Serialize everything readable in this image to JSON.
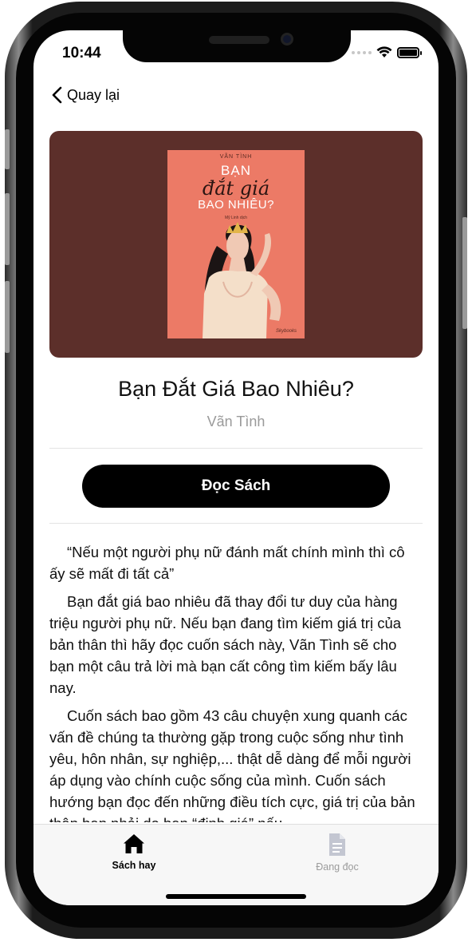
{
  "status_bar": {
    "time": "10:44"
  },
  "nav": {
    "back_label": "Quay lại"
  },
  "cover": {
    "author": "VÃN TÌNH",
    "title_line1": "BẠN",
    "title_line2": "đắt giá",
    "title_line3": "BAO NHIÊU?",
    "subtitle": "Mỹ Linh dịch",
    "publisher": "Skybooks"
  },
  "book": {
    "title": "Bạn Đắt Giá Bao Nhiêu?",
    "author": "Vãn Tình"
  },
  "actions": {
    "read_label": "Đọc Sách"
  },
  "description": [
    "“Nếu một người phụ nữ đánh mất chính mình thì cô ấy sẽ mất đi tất cả”",
    "Bạn đắt giá bao nhiêu đã thay đổi tư duy của hàng triệu người phụ nữ. Nếu bạn đang tìm kiếm giá trị của bản thân thì hãy đọc cuốn sách này, Vãn Tình sẽ cho bạn một câu trả lời mà bạn cất công tìm kiếm bấy lâu nay.",
    "Cuốn sách bao gồm 43 câu chuyện xung quanh các vấn đề chúng ta thường gặp trong cuộc sống như tình yêu, hôn nhân, sự nghiệp,... thật dễ dàng để mỗi người áp dụng vào chính cuộc sống của mình. Cuốn sách hướng bạn đọc đến những điều tích cực, giá trị của bản thân bạn phải do bạn “định giá” nếu"
  ],
  "tabs": [
    {
      "label": "Sách hay",
      "icon": "home-icon",
      "active": true
    },
    {
      "label": "Đang đọc",
      "icon": "document-icon",
      "active": false
    }
  ],
  "colors": {
    "cover_background": "#5c2f2a",
    "book_cover": "#ec7a66",
    "primary_button": "#000000",
    "tab_active": "#000000",
    "tab_inactive": "#9c9c9c"
  }
}
